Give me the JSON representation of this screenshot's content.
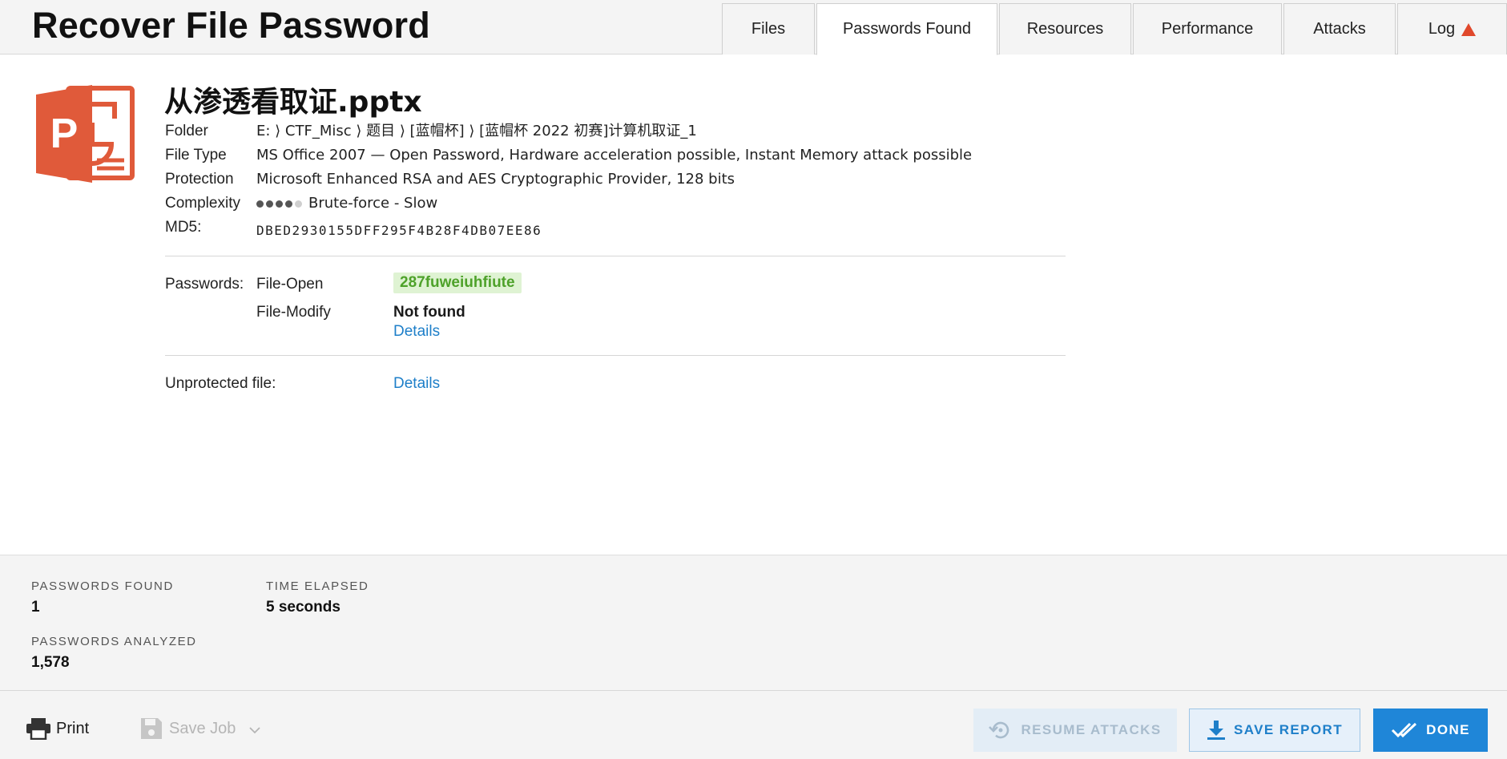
{
  "header": {
    "title": "Recover File Password",
    "tabs": [
      {
        "label": "Files"
      },
      {
        "label": "Passwords Found"
      },
      {
        "label": "Resources"
      },
      {
        "label": "Performance"
      },
      {
        "label": "Attacks"
      },
      {
        "label": "Log"
      }
    ],
    "active_tab": "Passwords Found"
  },
  "file": {
    "icon": "powerpoint-icon",
    "name": "从渗透看取证.pptx",
    "folder_label": "Folder",
    "folder_value": "E: ⟩ CTF_Misc ⟩ 题目 ⟩ [蓝帽杯] ⟩ [蓝帽杯 2022 初赛]计算机取证_1",
    "filetype_label": "File Type",
    "filetype_value": "MS Office 2007 — Open Password, Hardware acceleration possible, Instant Memory attack possible",
    "protection_label": "Protection",
    "protection_value": "Microsoft Enhanced RSA and AES Cryptographic Provider, 128 bits",
    "complexity_label": "Complexity",
    "complexity_level": 4,
    "complexity_max": 5,
    "complexity_value": "Brute-force - Slow",
    "md5_label": "MD5:",
    "md5_value": "DBED2930155DFF295F4B28F4DB07EE86"
  },
  "passwords": {
    "label": "Passwords:",
    "open_type": "File-Open",
    "open_value": "287fuweiuhfiute",
    "modify_type": "File-Modify",
    "modify_value": "Not found",
    "details_link": "Details",
    "unprotected_label": "Unprotected file:",
    "unprotected_link": "Details"
  },
  "stats": {
    "found_label": "PASSWORDS FOUND",
    "found_value": "1",
    "elapsed_label": "TIME ELAPSED",
    "elapsed_value": "5 seconds",
    "analyzed_label": "PASSWORDS ANALYZED",
    "analyzed_value": "1,578"
  },
  "footer": {
    "print_label": "Print",
    "save_job_label": "Save Job",
    "resume_label": "RESUME ATTACKS",
    "save_report_label": "SAVE REPORT",
    "done_label": "DONE"
  },
  "colors": {
    "accent": "#1f86d8",
    "link": "#1e7fc9",
    "found_green": "#4ea22a",
    "found_bg": "#dff3d3",
    "warning": "#e0482b",
    "ppt_orange": "#e05a3a"
  }
}
